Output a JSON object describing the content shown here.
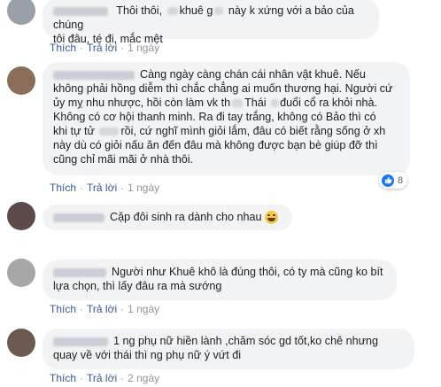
{
  "actions": {
    "like": "Thích",
    "reply": "Trả lời",
    "sep": "·"
  },
  "colors": {
    "link": "#385898",
    "bubble": "#f2f3f5",
    "meta": "#90949c",
    "like_blue": "#1877f2"
  },
  "comments": [
    {
      "lines": [
        "Thôi thôi, ",
        "khuê g",
        " này k xứng với a bảo của chúng",
        "tôi đâu, té đi, mắc mệt"
      ],
      "time": "1 ngày"
    },
    {
      "lines": [
        "Càng ngày càng chán cái nhân vật khuê. Nếu",
        "không phải hồng diễm thì chắc chẳng ai muốn thương hại. Người cứ",
        "ủy mỵ nhu nhược, hồi còn làm vk th",
        "Thái ",
        "đuổi cổ ra khỏi nhà.",
        "Không có cơ hội thanh minh. Ra đi tay trắng, không có Bảo thì có",
        "khi tự tử ",
        "rồi, cứ nghĩ mình giỏi lắm, đâu có biết rằng sống ở xh",
        "này dù có giỏi nấu ăn đến đâu mà không được bạn bè giúp đỡ thì",
        "cũng chỉ mãi mãi ở nhà thôi."
      ],
      "time": "1 ngày",
      "reactions": {
        "count": "8",
        "icon": "like-icon"
      }
    },
    {
      "lines": [
        "Cặp đôi sinh ra dành cho nhau"
      ],
      "emoji": "laughing-emoji"
    },
    {
      "lines": [
        "Người như Khuê khô là đúng thôi, có ty mà cũng ko bít",
        "lựa chọn, thì lấy đâu ra mà sướng"
      ],
      "time": "1 ngày"
    },
    {
      "lines": [
        "1 ng phụ nữ hiền lành ,chăm sóc gd tốt,ko chê nhưng",
        "quay về với thái thì ng phụ nữ ý vứt đi"
      ],
      "time": "2 ngày"
    }
  ]
}
